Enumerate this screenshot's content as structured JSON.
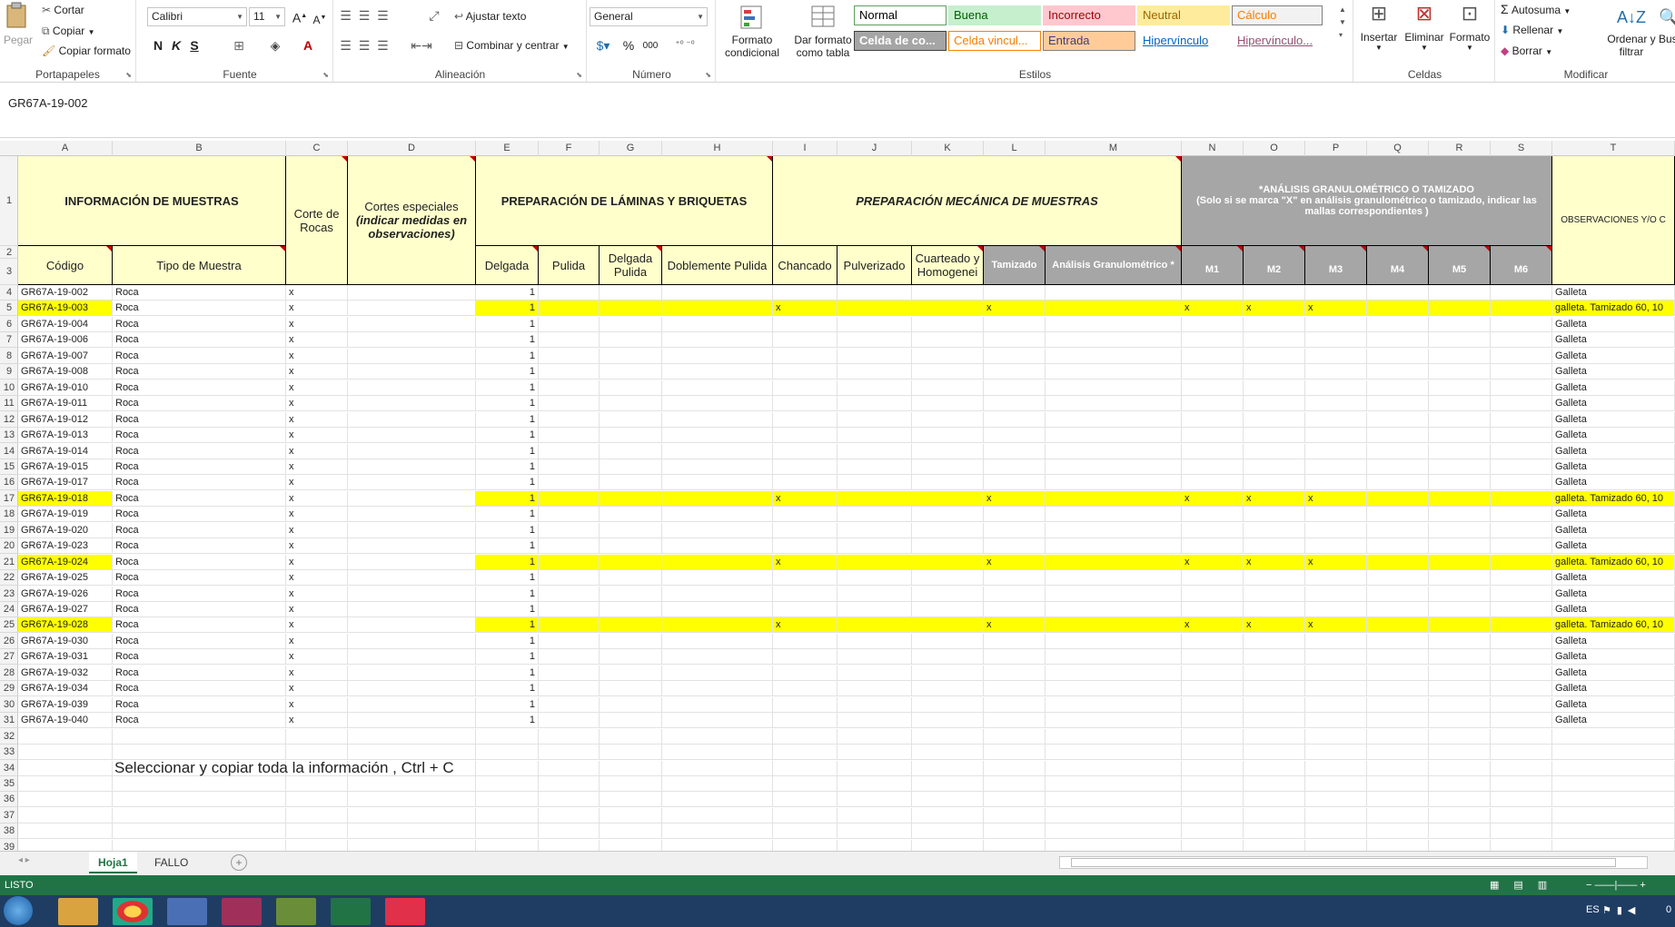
{
  "ribbon": {
    "portapapeles": {
      "paste": "Pegar",
      "cut": "Cortar",
      "copy": "Copiar",
      "format_painter": "Copiar formato",
      "label": "Portapapeles"
    },
    "fuente": {
      "font": "Calibri",
      "size": "11",
      "label": "Fuente",
      "bold": "N",
      "italic": "K",
      "underline": "S"
    },
    "alineacion": {
      "wrap": "Ajustar texto",
      "merge": "Combinar y centrar",
      "label": "Alineación"
    },
    "numero": {
      "format": "General",
      "label": "Número",
      "percent": "%",
      "thousands": "000"
    },
    "estilos": {
      "cond_format": "Formato condicional",
      "table_format": "Dar formato como tabla",
      "label": "Estilos",
      "styles": [
        {
          "name": "Normal",
          "bg": "#ffffff",
          "fg": "#000000",
          "border": "#5f9f5f"
        },
        {
          "name": "Buena",
          "bg": "#c6efce",
          "fg": "#006100",
          "border": "#c6efce"
        },
        {
          "name": "Incorrecto",
          "bg": "#ffc7ce",
          "fg": "#9c0006",
          "border": "#ffc7ce"
        },
        {
          "name": "Neutral",
          "bg": "#ffeb9c",
          "fg": "#9c6500",
          "border": "#ffeb9c"
        },
        {
          "name": "Cálculo",
          "bg": "#f2f2f2",
          "fg": "#fa7d00",
          "border": "#7f7f7f"
        },
        {
          "name": "Celda de co...",
          "bg": "#a5a5a5",
          "fg": "#ffffff",
          "border": "#3f3f3f"
        },
        {
          "name": "Celda vincul...",
          "bg": "#ffffff",
          "fg": "#fa7d00",
          "border": "#ff8001"
        },
        {
          "name": "Entrada",
          "bg": "#ffcc99",
          "fg": "#3f3f76",
          "border": "#7f7f7f"
        },
        {
          "name": "Hipervínculo",
          "bg": "#ffffff",
          "fg": "#0563c1",
          "border": "#ffffff"
        },
        {
          "name": "Hipervínculo...",
          "bg": "#ffffff",
          "fg": "#954f72",
          "border": "#ffffff"
        }
      ]
    },
    "celdas": {
      "insert": "Insertar",
      "delete": "Eliminar",
      "format": "Formato",
      "label": "Celdas"
    },
    "modificar": {
      "autosum": "Autosuma",
      "fill": "Rellenar",
      "clear": "Borrar",
      "sort": "Ordenar y filtrar",
      "find": "Buscar y seleccionar",
      "label": "Modificar"
    }
  },
  "namebox": {
    "value": "GR67A-19-002"
  },
  "columns": [
    "A",
    "B",
    "C",
    "D",
    "E",
    "F",
    "G",
    "H",
    "I",
    "J",
    "K",
    "L",
    "M",
    "N",
    "O",
    "P",
    "Q",
    "R",
    "S",
    "T"
  ],
  "headers": {
    "info": "INFORMACIÓN DE MUESTRAS",
    "codigo": "Código",
    "tipo": "Tipo de Muestra",
    "corte": "Corte de Rocas",
    "cortes_esp": "Cortes especiales",
    "cortes_esp2": "(indicar medidas en observaciones)",
    "laminas": "PREPARACIÓN DE LÁMINAS Y BRIQUETAS",
    "delgada": "Delgada",
    "pulida": "Pulida",
    "delgada_pulida": "Delgada Pulida",
    "doble": "Doblemente Pulida",
    "mecanica": "PREPARACIÓN MECÁNICA DE MUESTRAS",
    "chancado": "Chancado",
    "pulverizado": "Pulverizado",
    "cuarteado": "Cuarteado y Homogenei",
    "tamizado": "Tamizado",
    "analisis": "Análisis Granulométrico *",
    "gran_title": "*ANÁLISIS GRANULOMÉTRICO O TAMIZADO",
    "gran_sub": "(Solo si se marca \"X\" en análisis granulométrico o tamizado, indicar las mallas correspondientes )",
    "m": [
      "M1",
      "M2",
      "M3",
      "M4",
      "M5",
      "M6"
    ],
    "obs": "OBSERVACIONES Y/O C"
  },
  "rows": [
    {
      "n": "4",
      "code": "GR67A-19-002",
      "tipo": "Roca",
      "corte": "x",
      "del": "1",
      "hl": false,
      "obs": "Galleta"
    },
    {
      "n": "5",
      "code": "GR67A-19-003",
      "tipo": "Roca",
      "corte": "x",
      "del": "1",
      "hl": true,
      "obs": "galleta. Tamizado 60, 10"
    },
    {
      "n": "6",
      "code": "GR67A-19-004",
      "tipo": "Roca",
      "corte": "x",
      "del": "1",
      "hl": false,
      "obs": "Galleta"
    },
    {
      "n": "7",
      "code": "GR67A-19-006",
      "tipo": "Roca",
      "corte": "x",
      "del": "1",
      "hl": false,
      "obs": "Galleta"
    },
    {
      "n": "8",
      "code": "GR67A-19-007",
      "tipo": "Roca",
      "corte": "x",
      "del": "1",
      "hl": false,
      "obs": "Galleta"
    },
    {
      "n": "9",
      "code": "GR67A-19-008",
      "tipo": "Roca",
      "corte": "x",
      "del": "1",
      "hl": false,
      "obs": "Galleta"
    },
    {
      "n": "10",
      "code": "GR67A-19-010",
      "tipo": "Roca",
      "corte": "x",
      "del": "1",
      "hl": false,
      "obs": "Galleta"
    },
    {
      "n": "11",
      "code": "GR67A-19-011",
      "tipo": "Roca",
      "corte": "x",
      "del": "1",
      "hl": false,
      "obs": "Galleta"
    },
    {
      "n": "12",
      "code": "GR67A-19-012",
      "tipo": "Roca",
      "corte": "x",
      "del": "1",
      "hl": false,
      "obs": "Galleta"
    },
    {
      "n": "13",
      "code": "GR67A-19-013",
      "tipo": "Roca",
      "corte": "x",
      "del": "1",
      "hl": false,
      "obs": "Galleta"
    },
    {
      "n": "14",
      "code": "GR67A-19-014",
      "tipo": "Roca",
      "corte": "x",
      "del": "1",
      "hl": false,
      "obs": "Galleta"
    },
    {
      "n": "15",
      "code": "GR67A-19-015",
      "tipo": "Roca",
      "corte": "x",
      "del": "1",
      "hl": false,
      "obs": "Galleta"
    },
    {
      "n": "16",
      "code": "GR67A-19-017",
      "tipo": "Roca",
      "corte": "x",
      "del": "1",
      "hl": false,
      "obs": "Galleta"
    },
    {
      "n": "17",
      "code": "GR67A-19-018",
      "tipo": "Roca",
      "corte": "x",
      "del": "1",
      "hl": true,
      "obs": "galleta. Tamizado 60, 10"
    },
    {
      "n": "18",
      "code": "GR67A-19-019",
      "tipo": "Roca",
      "corte": "x",
      "del": "1",
      "hl": false,
      "obs": "Galleta"
    },
    {
      "n": "19",
      "code": "GR67A-19-020",
      "tipo": "Roca",
      "corte": "x",
      "del": "1",
      "hl": false,
      "obs": "Galleta"
    },
    {
      "n": "20",
      "code": "GR67A-19-023",
      "tipo": "Roca",
      "corte": "x",
      "del": "1",
      "hl": false,
      "obs": "Galleta"
    },
    {
      "n": "21",
      "code": "GR67A-19-024",
      "tipo": "Roca",
      "corte": "x",
      "del": "1",
      "hl": true,
      "obs": "galleta. Tamizado 60, 10"
    },
    {
      "n": "22",
      "code": "GR67A-19-025",
      "tipo": "Roca",
      "corte": "x",
      "del": "1",
      "hl": false,
      "obs": "Galleta"
    },
    {
      "n": "23",
      "code": "GR67A-19-026",
      "tipo": "Roca",
      "corte": "x",
      "del": "1",
      "hl": false,
      "obs": "Galleta"
    },
    {
      "n": "24",
      "code": "GR67A-19-027",
      "tipo": "Roca",
      "corte": "x",
      "del": "1",
      "hl": false,
      "obs": "Galleta"
    },
    {
      "n": "25",
      "code": "GR67A-19-028",
      "tipo": "Roca",
      "corte": "x",
      "del": "1",
      "hl": true,
      "obs": "galleta. Tamizado 60, 10"
    },
    {
      "n": "26",
      "code": "GR67A-19-030",
      "tipo": "Roca",
      "corte": "x",
      "del": "1",
      "hl": false,
      "obs": "Galleta"
    },
    {
      "n": "27",
      "code": "GR67A-19-031",
      "tipo": "Roca",
      "corte": "x",
      "del": "1",
      "hl": false,
      "obs": "Galleta"
    },
    {
      "n": "28",
      "code": "GR67A-19-032",
      "tipo": "Roca",
      "corte": "x",
      "del": "1",
      "hl": false,
      "obs": "Galleta"
    },
    {
      "n": "29",
      "code": "GR67A-19-034",
      "tipo": "Roca",
      "corte": "x",
      "del": "1",
      "hl": false,
      "obs": "Galleta"
    },
    {
      "n": "30",
      "code": "GR67A-19-039",
      "tipo": "Roca",
      "corte": "x",
      "del": "1",
      "hl": false,
      "obs": "Galleta"
    },
    {
      "n": "31",
      "code": "GR67A-19-040",
      "tipo": "Roca",
      "corte": "x",
      "del": "1",
      "hl": false,
      "obs": "Galleta"
    }
  ],
  "hl_mark": "x",
  "empty_rows": [
    "32",
    "33",
    "34",
    "35",
    "36",
    "37",
    "38",
    "39"
  ],
  "note": "Seleccionar y copiar toda la información , Ctrl + C",
  "header_rows": [
    "1",
    "2",
    "3"
  ],
  "tabs": [
    {
      "label": "Hoja1",
      "active": true
    },
    {
      "label": "FALLO",
      "active": false
    }
  ],
  "status": "LISTO",
  "taskbar": {
    "lang": "ES",
    "time": "0"
  },
  "colors": {
    "accent": "#217346",
    "header_yellow": "#ffffcc",
    "highlight": "#ffff00",
    "gray": "#a6a6a6"
  }
}
